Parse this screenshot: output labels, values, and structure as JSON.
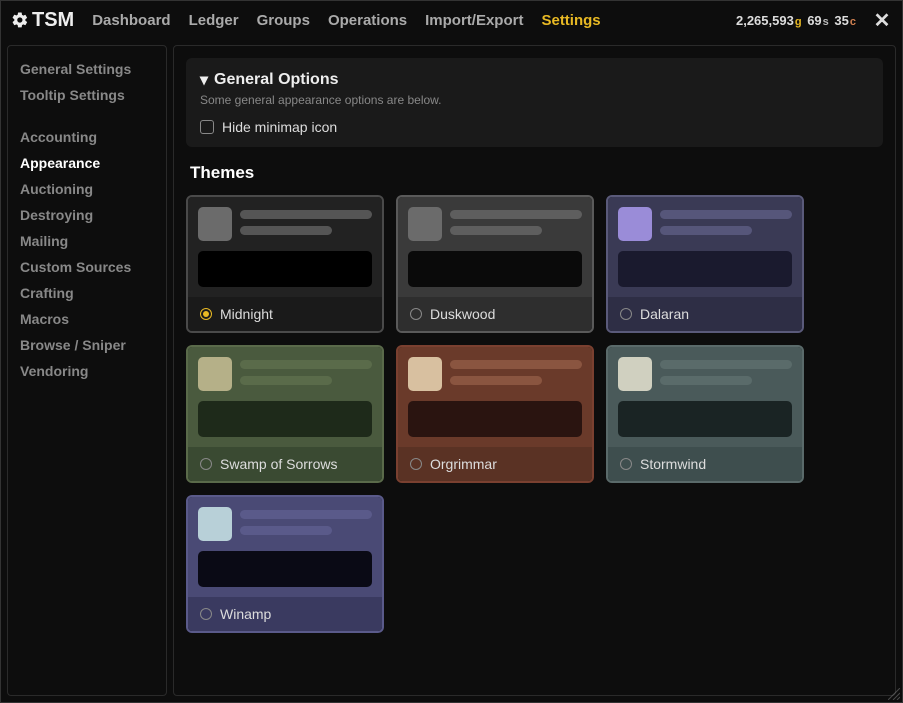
{
  "app": {
    "logo_text": "TSM"
  },
  "topnav": {
    "items": [
      {
        "label": "Dashboard"
      },
      {
        "label": "Ledger"
      },
      {
        "label": "Groups"
      },
      {
        "label": "Operations"
      },
      {
        "label": "Import/Export"
      },
      {
        "label": "Settings",
        "active": true
      }
    ]
  },
  "money": {
    "gold": "2,265,593",
    "silver": "69",
    "copper": "35"
  },
  "sidebar": {
    "group1": [
      {
        "label": "General Settings"
      },
      {
        "label": "Tooltip Settings"
      }
    ],
    "group2": [
      {
        "label": "Accounting"
      },
      {
        "label": "Appearance",
        "active": true
      },
      {
        "label": "Auctioning"
      },
      {
        "label": "Destroying"
      },
      {
        "label": "Mailing"
      },
      {
        "label": "Custom Sources"
      },
      {
        "label": "Crafting"
      },
      {
        "label": "Macros"
      },
      {
        "label": "Browse / Sniper"
      },
      {
        "label": "Vendoring"
      }
    ]
  },
  "general_options": {
    "title": "General Options",
    "subtitle": "Some general appearance options are below.",
    "hide_minimap": "Hide minimap icon"
  },
  "themes": {
    "title": "Themes",
    "items": [
      {
        "name": "Midnight",
        "selected": true,
        "border": "#4a4a4a",
        "bg_upper": "#222222",
        "bg_lower": "#1a1a1a",
        "square": "#6b6b6b",
        "line": "#555555",
        "bar": "#000000"
      },
      {
        "name": "Duskwood",
        "selected": false,
        "border": "#5a5a5a",
        "bg_upper": "#3a3a3a",
        "bg_lower": "#2e2e2e",
        "square": "#6b6b6b",
        "line": "#5e5e5e",
        "bar": "#0a0a0a"
      },
      {
        "name": "Dalaran",
        "selected": false,
        "border": "#5a5a7a",
        "bg_upper": "#3a3a55",
        "bg_lower": "#2e2e45",
        "square": "#9a8cd8",
        "line": "#56567a",
        "bar": "#1a1a2e"
      },
      {
        "name": "Swamp of Sorrows",
        "selected": false,
        "border": "#5a6a4a",
        "bg_upper": "#4a5a3e",
        "bg_lower": "#3a4a32",
        "square": "#b5b088",
        "line": "#5a6b4a",
        "bar": "#1e2a1a"
      },
      {
        "name": "Orgrimmar",
        "selected": false,
        "border": "#7a4030",
        "bg_upper": "#6a3a2a",
        "bg_lower": "#5a3224",
        "square": "#d8c0a0",
        "line": "#8a5540",
        "bar": "#2a1410"
      },
      {
        "name": "Stormwind",
        "selected": false,
        "border": "#5a6a6a",
        "bg_upper": "#4a5a5a",
        "bg_lower": "#3e4e4e",
        "square": "#d0d0c0",
        "line": "#5a6b6a",
        "bar": "#1a2424"
      },
      {
        "name": "Winamp",
        "selected": false,
        "border": "#5a5a8a",
        "bg_upper": "#4a4a75",
        "bg_lower": "#3a3a60",
        "square": "#b8d0d8",
        "line": "#5a5a8a",
        "bar": "#0a0a15"
      }
    ]
  }
}
